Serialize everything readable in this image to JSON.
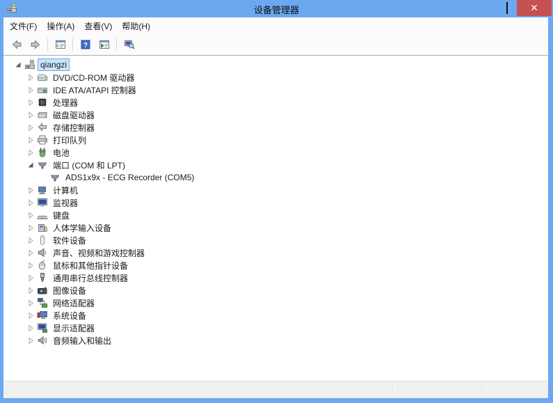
{
  "window": {
    "title": "设备管理器",
    "app_icon": "device-manager-icon",
    "controls": [
      {
        "name": "minimize-button",
        "icon": "minimize-icon"
      },
      {
        "name": "maximize-button",
        "icon": "maximize-icon"
      },
      {
        "name": "close-button",
        "icon": "close-icon"
      }
    ]
  },
  "menubar": {
    "items": [
      {
        "name": "menu-file",
        "label": "文件(F)"
      },
      {
        "name": "menu-action",
        "label": "操作(A)"
      },
      {
        "name": "menu-view",
        "label": "查看(V)"
      },
      {
        "name": "menu-help",
        "label": "帮助(H)"
      }
    ]
  },
  "toolbar": {
    "buttons": [
      {
        "type": "button",
        "name": "back-button",
        "icon": "back-arrow-icon"
      },
      {
        "type": "button",
        "name": "forward-button",
        "icon": "forward-arrow-icon"
      },
      {
        "type": "separator"
      },
      {
        "type": "button",
        "name": "show-hide-console-tree-button",
        "icon": "console-tree-icon"
      },
      {
        "type": "separator"
      },
      {
        "type": "button",
        "name": "help-button",
        "icon": "help-icon"
      },
      {
        "type": "button",
        "name": "properties-button",
        "icon": "properties-icon"
      },
      {
        "type": "separator"
      },
      {
        "type": "button",
        "name": "scan-hardware-changes-button",
        "icon": "scan-hardware-icon"
      }
    ]
  },
  "tree": {
    "items": [
      {
        "label": "qiangzi",
        "level": 0,
        "state": "expanded",
        "icon": "device-manager-icon",
        "selected": true
      },
      {
        "label": "DVD/CD-ROM 驱动器",
        "level": 1,
        "state": "collapsed",
        "icon": "dvd-drive-icon"
      },
      {
        "label": "IDE ATA/ATAPI 控制器",
        "level": 1,
        "state": "collapsed",
        "icon": "ide-controller-icon"
      },
      {
        "label": "处理器",
        "level": 1,
        "state": "collapsed",
        "icon": "processor-icon"
      },
      {
        "label": "磁盘驱动器",
        "level": 1,
        "state": "collapsed",
        "icon": "disk-drive-icon"
      },
      {
        "label": "存储控制器",
        "level": 1,
        "state": "collapsed",
        "icon": "storage-controller-icon"
      },
      {
        "label": "打印队列",
        "level": 1,
        "state": "collapsed",
        "icon": "print-queue-icon"
      },
      {
        "label": "电池",
        "level": 1,
        "state": "collapsed",
        "icon": "battery-icon"
      },
      {
        "label": "端口 (COM 和 LPT)",
        "level": 1,
        "state": "expanded",
        "icon": "serial-port-icon"
      },
      {
        "label": "ADS1x9x - ECG Recorder (COM5)",
        "level": 2,
        "state": "none",
        "icon": "serial-port-icon"
      },
      {
        "label": "计算机",
        "level": 1,
        "state": "collapsed",
        "icon": "computer-icon"
      },
      {
        "label": "监视器",
        "level": 1,
        "state": "collapsed",
        "icon": "monitor-icon"
      },
      {
        "label": "键盘",
        "level": 1,
        "state": "collapsed",
        "icon": "keyboard-icon"
      },
      {
        "label": "人体学输入设备",
        "level": 1,
        "state": "collapsed",
        "icon": "hid-icon"
      },
      {
        "label": "软件设备",
        "level": 1,
        "state": "collapsed",
        "icon": "software-device-icon"
      },
      {
        "label": "声音、视频和游戏控制器",
        "level": 1,
        "state": "collapsed",
        "icon": "sound-controller-icon"
      },
      {
        "label": "鼠标和其他指针设备",
        "level": 1,
        "state": "collapsed",
        "icon": "mouse-icon"
      },
      {
        "label": "通用串行总线控制器",
        "level": 1,
        "state": "collapsed",
        "icon": "usb-controller-icon"
      },
      {
        "label": "图像设备",
        "level": 1,
        "state": "collapsed",
        "icon": "imaging-device-icon"
      },
      {
        "label": "网络适配器",
        "level": 1,
        "state": "collapsed",
        "icon": "network-adapter-icon"
      },
      {
        "label": "系统设备",
        "level": 1,
        "state": "collapsed",
        "icon": "system-device-icon"
      },
      {
        "label": "显示适配器",
        "level": 1,
        "state": "collapsed",
        "icon": "display-adapter-icon"
      },
      {
        "label": "音频输入和输出",
        "level": 1,
        "state": "collapsed",
        "icon": "audio-io-icon"
      }
    ]
  },
  "statusbar": {
    "sections": [
      "",
      "",
      ""
    ]
  },
  "colors": {
    "titlebar_blue": "#6BA8EF",
    "close_button_red": "#C75050",
    "selection_bg": "#CBE5FC",
    "selection_border": "#66A7E8",
    "status_bg": "#F0F0F0",
    "content_bg": "#FFFFFF"
  }
}
